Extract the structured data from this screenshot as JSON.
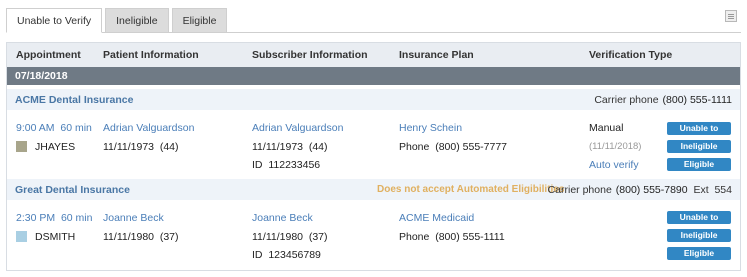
{
  "tabs": [
    {
      "label": "Unable to Verify",
      "active": true
    },
    {
      "label": "Ineligible",
      "active": false
    },
    {
      "label": "Eligible",
      "active": false
    }
  ],
  "columns": {
    "appointment": "Appointment",
    "patient": "Patient Information",
    "subscriber": "Subscriber Information",
    "plan": "Insurance Plan",
    "verification": "Verification Type"
  },
  "date": "07/18/2018",
  "groups": [
    {
      "carrier": "ACME Dental Insurance",
      "carrier_phone_label": "Carrier phone",
      "carrier_phone": "(800) 555-1111",
      "appointment": {
        "time": "9:00 AM",
        "duration": "60 min",
        "provider": "JHAYES",
        "provider_color": "#a8a58b",
        "patient_name": "Adrian Valguardson",
        "patient_dob": "11/11/1973",
        "patient_age": "(44)",
        "subscriber_name": "Adrian Valguardson",
        "subscriber_dob": "11/11/1973",
        "subscriber_age": "(44)",
        "subscriber_id_label": "ID",
        "subscriber_id": "112233456",
        "plan_name": "Henry Schein",
        "plan_phone_label": "Phone",
        "plan_phone": "(800) 555-7777",
        "verification_type": "Manual",
        "verification_date": "(11/11/2018)",
        "auto_verify": "Auto verify"
      }
    },
    {
      "carrier": "Great Dental Insurance",
      "warning": "Does not accept Automated Eligibilities",
      "carrier_phone_label": "Carrier phone",
      "carrier_phone": "(800) 555-7890",
      "ext_label": "Ext",
      "ext": "554",
      "appointment": {
        "time": "2:30 PM",
        "duration": "60 min",
        "provider": "DSMITH",
        "provider_color": "#a9cfe3",
        "patient_name": "Joanne Beck",
        "patient_dob": "11/11/1980",
        "patient_age": "(37)",
        "subscriber_name": "Joanne Beck",
        "subscriber_dob": "11/11/1980",
        "subscriber_age": "(37)",
        "subscriber_id_label": "ID",
        "subscriber_id": "123456789",
        "plan_name": "ACME Medicaid",
        "plan_phone_label": "Phone",
        "plan_phone": "(800) 555-1111"
      }
    }
  ],
  "buttons": {
    "unable": "Unable to Verify",
    "ineligible": "Ineligible",
    "eligible": "Eligible"
  },
  "colors": {
    "link": "#4a7eb8",
    "button": "#3187c4",
    "date_band": "#6f7a85",
    "warning": "#e0b060"
  },
  "icons": {
    "corner": "list-icon"
  }
}
